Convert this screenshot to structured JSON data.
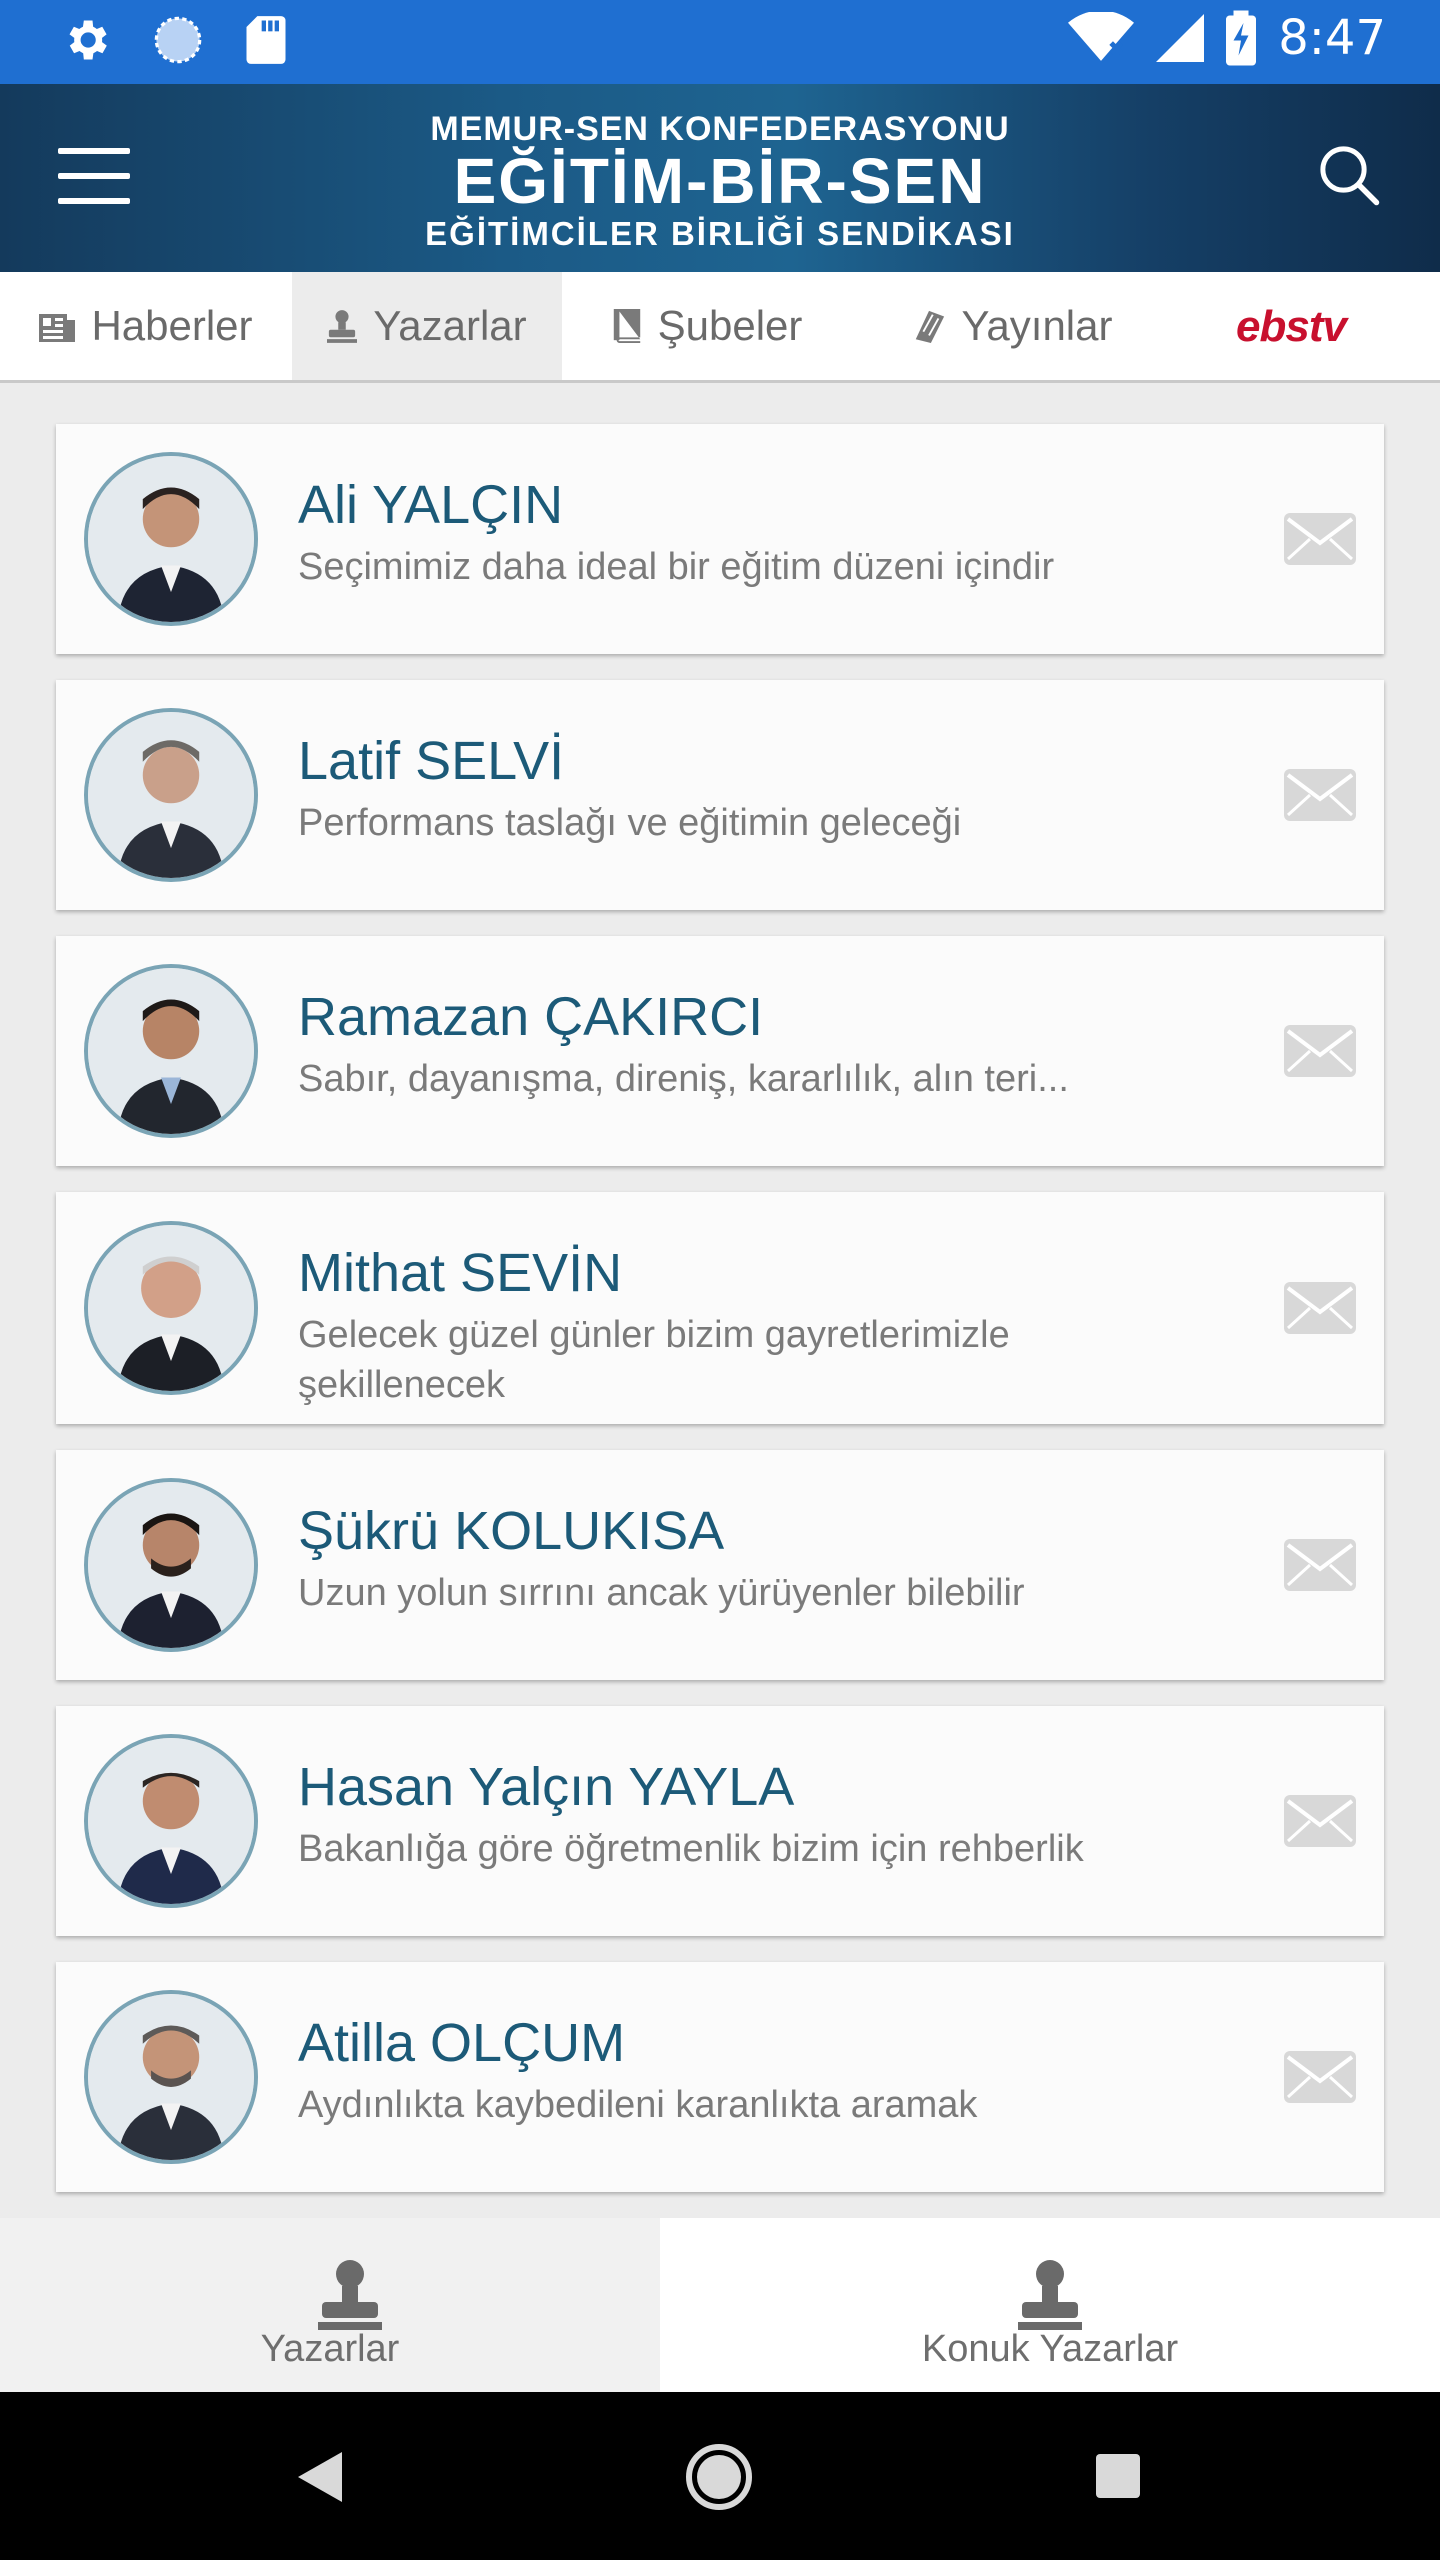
{
  "status_bar": {
    "time": "8:47",
    "icons": [
      "settings-gear-icon",
      "sync-circle-icon",
      "sd-card-icon",
      "wifi-icon",
      "cell-signal-icon",
      "battery-charging-icon"
    ]
  },
  "header": {
    "brand_line1": "MEMUR-SEN KONFEDERASYONU",
    "brand_line2": "EĞİTİM-BİR-SEN",
    "brand_line3": "EĞİTİMCİLER BİRLİĞİ SENDİKASI",
    "icons": [
      "hamburger-menu-icon",
      "search-icon"
    ]
  },
  "tabs": [
    {
      "label": "Haberler",
      "icon": "newspaper-icon",
      "active": false
    },
    {
      "label": "Yazarlar",
      "icon": "person-stamp-icon",
      "active": true
    },
    {
      "label": "Şubeler",
      "icon": "book-icon",
      "active": false
    },
    {
      "label": "Yayınlar",
      "icon": "tag-icon",
      "active": false
    },
    {
      "label": "ebstv",
      "icon": "ebs-tv-logo",
      "active": false
    }
  ],
  "authors": [
    {
      "name": "Ali YALÇIN",
      "quote": "Seçimimiz daha ideal bir eğitim düzeni içindir"
    },
    {
      "name": "Latif SELVİ",
      "quote": "Performans taslağı ve eğitimin geleceği"
    },
    {
      "name": "Ramazan ÇAKIRCI",
      "quote": "Sabır, dayanışma, direniş, kararlılık, alın teri..."
    },
    {
      "name": "Mithat SEVİN",
      "quote": "Gelecek güzel günler bizim gayretlerimizle şekillenecek"
    },
    {
      "name": "Şükrü KOLUKISA",
      "quote": "Uzun yolun sırrını ancak yürüyenler bilebilir"
    },
    {
      "name": "Hasan Yalçın YAYLA",
      "quote": "Bakanlığa göre öğretmenlik bizim için rehberlik"
    },
    {
      "name": "Atilla OLÇUM",
      "quote": "Aydınlıkta kaybedileni karanlıkta aramak"
    }
  ],
  "bottom_tabs": [
    {
      "label": "Yazarlar",
      "icon": "person-stamp-icon",
      "active": false
    },
    {
      "label": "Konuk Yazarlar",
      "icon": "person-stamp-icon",
      "active": true
    }
  ],
  "nav_bar": {
    "icons": [
      "back-icon",
      "home-icon",
      "recents-icon"
    ]
  },
  "colors": {
    "status_bar": "#1f6fd1",
    "header_dark": "#143a5c",
    "header_mid": "#1e6491",
    "author_name": "#1c5a78",
    "ebs_red": "#c8102e",
    "avatar_border": "#7aa4b5"
  }
}
